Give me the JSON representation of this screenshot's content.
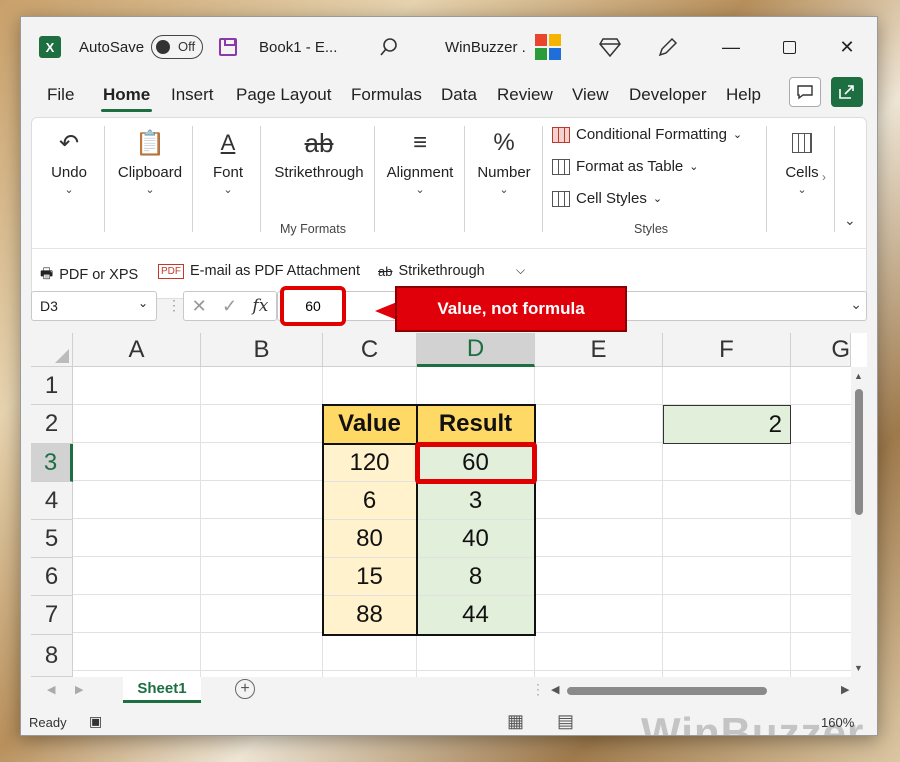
{
  "titlebar": {
    "app_icon": "excel-icon",
    "autosave_label": "AutoSave",
    "autosave_state": "Off",
    "doc_title": "Book1  -  E...",
    "account_name": "WinBuzzer ."
  },
  "tabs": [
    "File",
    "Home",
    "Insert",
    "Page Layout",
    "Formulas",
    "Data",
    "Review",
    "View",
    "Developer",
    "Help"
  ],
  "active_tab": "Home",
  "ribbon": {
    "undo": "Undo",
    "clipboard": "Clipboard",
    "font": "Font",
    "strikethrough": "Strikethrough",
    "my_formats_group": "My Formats",
    "alignment": "Alignment",
    "number": "Number",
    "conditional_formatting": "Conditional Formatting",
    "format_as_table": "Format as Table",
    "cell_styles": "Cell Styles",
    "styles_group": "Styles",
    "cells": "Cells"
  },
  "qat": {
    "pdf_xps": "PDF or XPS",
    "email_pdf": "E-mail as PDF Attachment",
    "strikethrough": "Strikethrough"
  },
  "formula_bar": {
    "name_box": "D3",
    "fx": "fx",
    "value": "60",
    "callout": "Value, not formula"
  },
  "grid": {
    "columns": [
      "A",
      "B",
      "C",
      "D",
      "E",
      "F",
      "G"
    ],
    "selected_column": "D",
    "rows": [
      "1",
      "2",
      "3",
      "4",
      "5",
      "6",
      "7",
      "8"
    ],
    "selected_row": "3",
    "table_headers": [
      "Value",
      "Result"
    ],
    "table_rows": [
      {
        "value": "120",
        "result": "60"
      },
      {
        "value": "6",
        "result": "3"
      },
      {
        "value": "80",
        "result": "40"
      },
      {
        "value": "15",
        "result": "8"
      },
      {
        "value": "88",
        "result": "44"
      }
    ],
    "f2_value": "2"
  },
  "sheets": {
    "active": "Sheet1"
  },
  "status": {
    "ready": "Ready",
    "zoom": "160%",
    "watermark": "WinBuzzer"
  },
  "colors": {
    "excel_green": "#1d6f42",
    "header_fill": "#ffd966",
    "value_fill": "#fff2cc",
    "result_fill": "#e2efda",
    "highlight_red": "#e00000"
  }
}
